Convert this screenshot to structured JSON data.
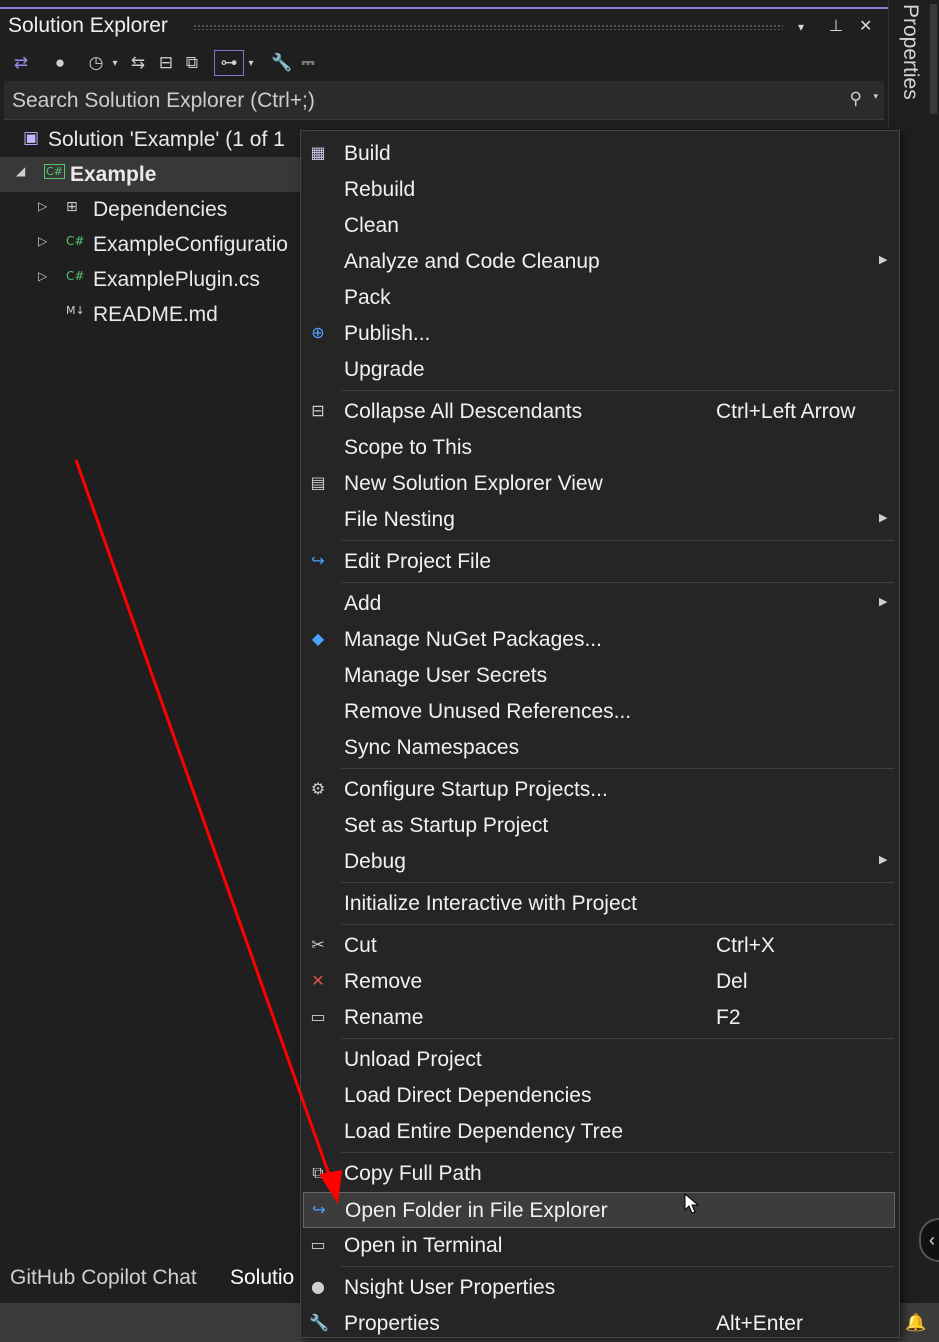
{
  "panel": {
    "title": "Solution Explorer",
    "window_buttons": {
      "dropdown": "▾",
      "pin": "⊥",
      "close": "✕"
    },
    "search": {
      "placeholder": "Search Solution Explorer (Ctrl+;)"
    }
  },
  "tree": {
    "solution": "Solution 'Example' (1 of 1",
    "project": "Example",
    "project_icon": "C#",
    "items": [
      {
        "label": "Dependencies",
        "icon": "⊞",
        "expandable": true
      },
      {
        "label": "ExampleConfiguratio",
        "icon": "C#",
        "expandable": true
      },
      {
        "label": "ExamplePlugin.cs",
        "icon": "C#",
        "expandable": true
      },
      {
        "label": "README.md",
        "icon": "M↓",
        "expandable": false
      }
    ]
  },
  "bottom_tabs": [
    {
      "label": "GitHub Copilot Chat",
      "active": false
    },
    {
      "label": "Solutio",
      "active": true
    }
  ],
  "side_panel": {
    "label": "Properties"
  },
  "context_menu": {
    "items": [
      {
        "label": "Build",
        "icon": "build-icon",
        "glyph": "▦"
      },
      {
        "label": "Rebuild"
      },
      {
        "label": "Clean"
      },
      {
        "label": "Analyze and Code Cleanup",
        "submenu": true
      },
      {
        "label": "Pack"
      },
      {
        "label": "Publish...",
        "icon": "globe-icon",
        "glyph": "⊕"
      },
      {
        "label": "Upgrade",
        "sep_after": true
      },
      {
        "label": "Collapse All Descendants",
        "icon": "collapse-icon",
        "glyph": "⊟",
        "shortcut": "Ctrl+Left Arrow"
      },
      {
        "label": "Scope to This"
      },
      {
        "label": "New Solution Explorer View",
        "icon": "new-view-icon",
        "glyph": "▤"
      },
      {
        "label": "File Nesting",
        "submenu": true,
        "sep_after": true
      },
      {
        "label": "Edit Project File",
        "icon": "edit-project-icon",
        "glyph": "↪",
        "sep_after": true
      },
      {
        "label": "Add",
        "submenu": true
      },
      {
        "label": "Manage NuGet Packages...",
        "icon": "nuget-icon",
        "glyph": "◆"
      },
      {
        "label": "Manage User Secrets"
      },
      {
        "label": "Remove Unused References..."
      },
      {
        "label": "Sync Namespaces",
        "sep_after": true
      },
      {
        "label": "Configure Startup Projects...",
        "icon": "gear-icon",
        "glyph": "⚙"
      },
      {
        "label": "Set as Startup Project"
      },
      {
        "label": "Debug",
        "submenu": true,
        "sep_after": true
      },
      {
        "label": "Initialize Interactive with Project",
        "sep_after": true
      },
      {
        "label": "Cut",
        "icon": "scissors-icon",
        "glyph": "✂",
        "shortcut": "Ctrl+X"
      },
      {
        "label": "Remove",
        "icon": "remove-icon",
        "glyph": "✕",
        "shortcut": "Del"
      },
      {
        "label": "Rename",
        "icon": "rename-icon",
        "glyph": "▭",
        "shortcut": "F2",
        "sep_after": true
      },
      {
        "label": "Unload Project"
      },
      {
        "label": "Load Direct Dependencies"
      },
      {
        "label": "Load Entire Dependency Tree",
        "sep_after": true
      },
      {
        "label": "Copy Full Path",
        "icon": "copy-icon",
        "glyph": "⧉"
      },
      {
        "label": "Open Folder in File Explorer",
        "icon": "open-folder-icon",
        "glyph": "↪",
        "highlighted": true
      },
      {
        "label": "Open in Terminal",
        "icon": "terminal-icon",
        "glyph": "▭",
        "sep_after": true
      },
      {
        "label": "Nsight User Properties",
        "icon": "nsight-icon",
        "glyph": "●"
      },
      {
        "label": "Properties",
        "icon": "wrench-icon",
        "glyph": "🔧",
        "shortcut": "Alt+Enter"
      }
    ]
  },
  "colors": {
    "background": "#1f1f1f",
    "menu_background": "#252526",
    "accent": "#8a7fd6",
    "csharp_green": "#57c46c",
    "annotation_red": "#ff0000",
    "remove_red": "#e05252",
    "icon_blue": "#4aa3ff"
  }
}
